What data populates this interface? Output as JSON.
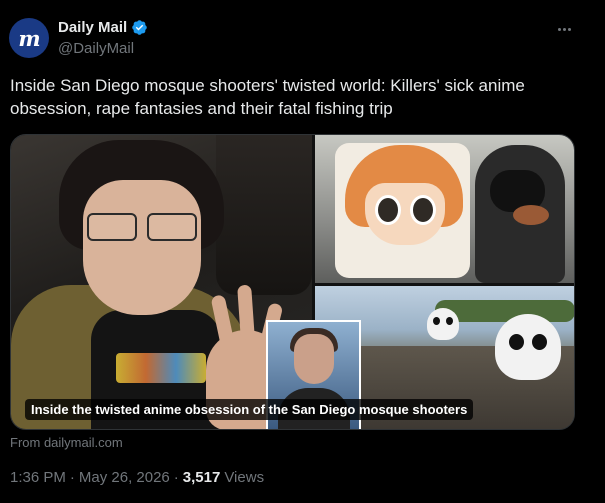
{
  "account": {
    "display_name": "Daily Mail",
    "handle": "@DailyMail",
    "avatar_letter": "m",
    "verified": true,
    "avatar_color": "#1a3a85",
    "badge_color": "#1d9bf0"
  },
  "tweet": {
    "text": "Inside San Diego mosque shooters' twisted world: Killers' sick anime obsession, rape fantasies and their fatal fishing trip"
  },
  "card": {
    "caption": "Inside the twisted anime obsession of the San Diego mosque shooters",
    "source": "From dailymail.com"
  },
  "meta": {
    "time": "1:36 PM",
    "date": "May 26, 2026",
    "separator": "·",
    "views_count": "3,517",
    "views_label": "Views"
  },
  "icons": {
    "more": "more-options-icon",
    "verified": "verified-badge-icon"
  }
}
